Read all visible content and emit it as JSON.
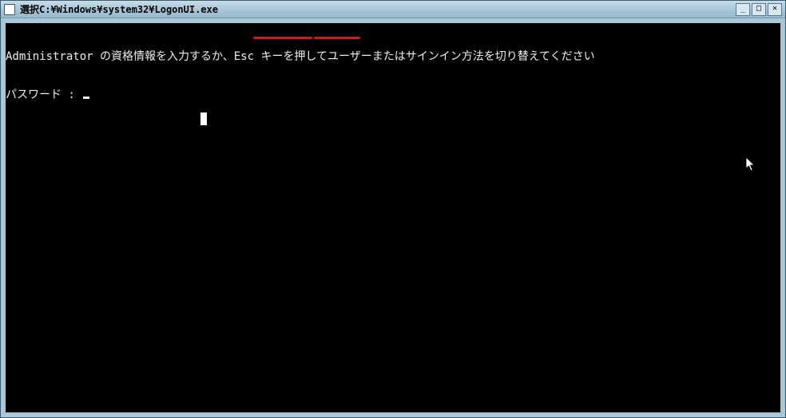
{
  "window": {
    "title": "選択C:¥Windows¥system32¥LogonUI.exe"
  },
  "controls": {
    "minimize": "_",
    "maximize": "□",
    "close": "✕"
  },
  "terminal": {
    "line1": "Administrator の資格情報を入力するか、Esc キーを押してユーザーまたはサインイン方法を切り替えてください",
    "line2_label": "パスワード : "
  }
}
